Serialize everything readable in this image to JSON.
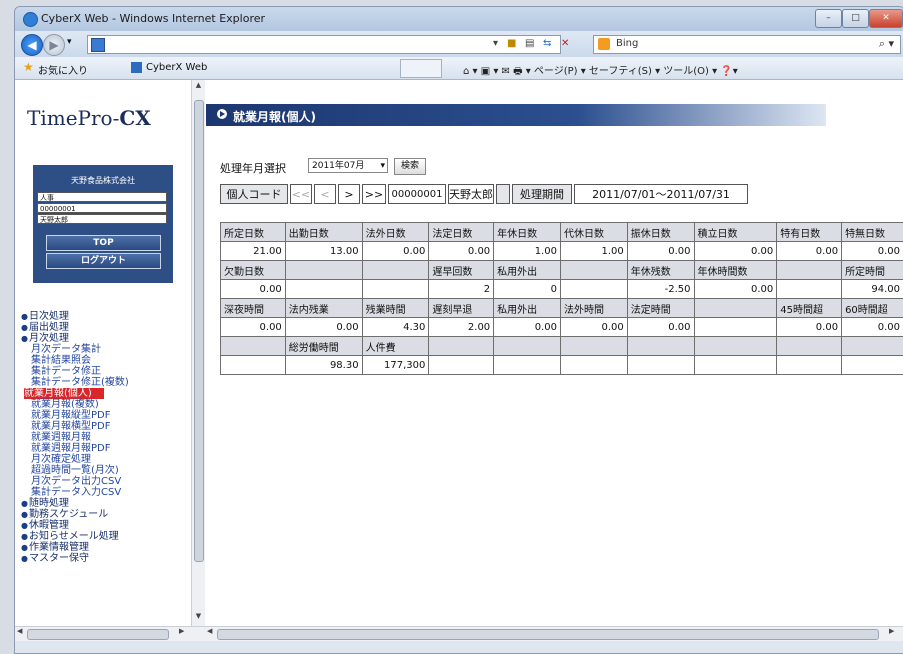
{
  "window": {
    "title": "CyberX Web - Windows Internet Explorer",
    "controls": [
      "–",
      "□",
      "✕"
    ]
  },
  "address_bar": {
    "url": "",
    "search_text": "Bing",
    "buttons": [
      "▾",
      "🔒",
      "⟳",
      "⇆",
      "✕"
    ]
  },
  "favorites_bar": {
    "favorites_label": "お気に入り",
    "tab_label": "CyberX Web",
    "tools": "⌂ ▾ ▣ ▾ ✉ 🖶 ▾ ページ(P) ▾ セーフティ(S) ▾ ツール(O) ▾ ❓▾"
  },
  "sidebar": {
    "logo_main": "TimePro-",
    "logo_bold": "CX",
    "company": "天野食品株式会社",
    "dept": "人事",
    "employee_no": "00000001",
    "employee_name": "天野太郎",
    "top_button": "TOP",
    "logout_button": "ログアウト",
    "menu": [
      {
        "label": "日次処理",
        "type": "top"
      },
      {
        "label": "届出処理",
        "type": "top"
      },
      {
        "label": "月次処理",
        "type": "top"
      },
      {
        "label": "月次データ集計",
        "type": "sub"
      },
      {
        "label": "集計結果照会",
        "type": "sub"
      },
      {
        "label": "集計データ修正",
        "type": "sub"
      },
      {
        "label": "集計データ修正(複数)",
        "type": "sub"
      },
      {
        "label": "就業月報(個人)",
        "type": "sel"
      },
      {
        "label": "就業月報(複数)",
        "type": "sub"
      },
      {
        "label": "就業月報縦型PDF",
        "type": "sub"
      },
      {
        "label": "就業月報横型PDF",
        "type": "sub"
      },
      {
        "label": "就業週報月報",
        "type": "sub"
      },
      {
        "label": "就業週報月報PDF",
        "type": "sub"
      },
      {
        "label": "月次確定処理",
        "type": "sub"
      },
      {
        "label": "超過時間一覧(月次)",
        "type": "sub"
      },
      {
        "label": "月次データ出力CSV",
        "type": "sub"
      },
      {
        "label": "集計データ入力CSV",
        "type": "sub"
      },
      {
        "label": "随時処理",
        "type": "top"
      },
      {
        "label": "勤務スケジュール",
        "type": "top"
      },
      {
        "label": "休暇管理",
        "type": "top"
      },
      {
        "label": "お知らせメール処理",
        "type": "top"
      },
      {
        "label": "作業情報管理",
        "type": "top"
      },
      {
        "label": "マスター保守",
        "type": "top"
      }
    ]
  },
  "main": {
    "header": "就業月報(個人)",
    "select_label": "処理年月選択",
    "month_value": "2011年07月",
    "search_button": "検索",
    "nav": {
      "person_code_label": "個人コード",
      "first": "<<",
      "prev": "<",
      "next": ">",
      "last": ">>",
      "code": "00000001",
      "name": "天野太郎",
      "period_label": "処理期間",
      "period": "2011/07/01〜2011/07/31"
    },
    "table": [
      [
        "所定日数",
        "出勤日数",
        "法外日数",
        "法定日数",
        "年休日数",
        "代休日数",
        "振休日数",
        "積立日数",
        "特有日数",
        "特無日数"
      ],
      [
        "21.00",
        "13.00",
        "0.00",
        "0.00",
        "1.00",
        "1.00",
        "0.00",
        "0.00",
        "0.00",
        "0.00"
      ],
      [
        "欠勤日数",
        "",
        "",
        "遅早回数",
        "私用外出",
        "",
        "年休残数",
        "年休時間数",
        "",
        "所定時間"
      ],
      [
        "0.00",
        "",
        "",
        "2",
        "0",
        "",
        "-2.50",
        "0.00",
        "",
        "94.00"
      ],
      [
        "深夜時間",
        "法内残業",
        "残業時間",
        "遅刻早退",
        "私用外出",
        "法外時間",
        "法定時間",
        "",
        "45時間超",
        "60時間超"
      ],
      [
        "0.00",
        "0.00",
        "4.30",
        "2.00",
        "0.00",
        "0.00",
        "0.00",
        "",
        "0.00",
        "0.00"
      ],
      [
        "",
        "総労働時間",
        "人件費",
        "",
        "",
        "",
        "",
        "",
        "",
        ""
      ],
      [
        "",
        "98.30",
        "177,300",
        "",
        "",
        "",
        "",
        "",
        "",
        ""
      ]
    ]
  }
}
